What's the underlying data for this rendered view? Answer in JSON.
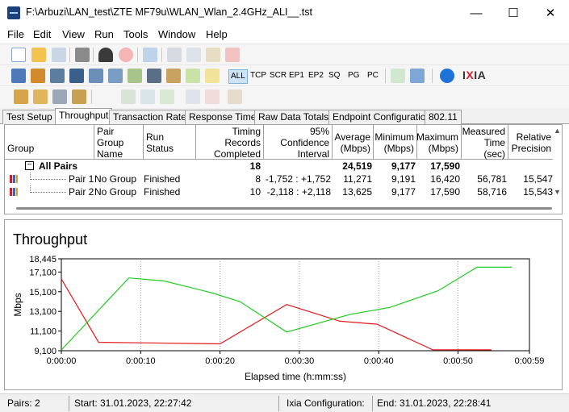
{
  "window": {
    "title": "F:\\Arbuzi\\LAN_test\\ZTE MF79u\\WLAN_Wlan_2.4GHz_ALI__.tst",
    "minimize": "—",
    "maximize": "☐",
    "close": "✕"
  },
  "menu": [
    "File",
    "Edit",
    "View",
    "Run",
    "Tools",
    "Window",
    "Help"
  ],
  "toolbar2": {
    "all": "ALL",
    "tcp": "TCP",
    "scr": "SCR",
    "ep1": "EP1",
    "ep2": "EP2",
    "sq": "SQ",
    "pg": "PG",
    "pc": "PC",
    "logo_i": "I",
    "logo_x": "X",
    "logo_rest": "IA"
  },
  "tabs": [
    "Test Setup",
    "Throughput",
    "Transaction Rate",
    "Response Time",
    "Raw Data Totals",
    "Endpoint Configuration",
    "802.11"
  ],
  "table": {
    "headers": {
      "group": "Group",
      "pair_group_name": "Pair Group Name",
      "run_status": "Run Status",
      "timing_records": "Timing Records Completed",
      "confidence": "95% Confidence Interval",
      "average": "Average (Mbps)",
      "minimum": "Minimum (Mbps)",
      "maximum": "Maximum (Mbps)",
      "measured_time": "Measured Time (sec)",
      "relative_precision": "Relative Precision"
    },
    "all_pairs": {
      "expander": "−",
      "label": "All Pairs",
      "records": "18",
      "average": "24,519",
      "minimum": "9,177",
      "maximum": "17,590"
    },
    "rows": [
      {
        "pair": "Pair 1",
        "group": "No Group",
        "status": "Finished",
        "records": "8",
        "ci": "-1,752 : +1,752",
        "average": "11,271",
        "minimum": "9,191",
        "maximum": "16,420",
        "time": "56,781",
        "precision": "15,547"
      },
      {
        "pair": "Pair 2",
        "group": "No Group",
        "status": "Finished",
        "records": "10",
        "ci": "-2,118 : +2,118",
        "average": "13,625",
        "minimum": "9,177",
        "maximum": "17,590",
        "time": "58,716",
        "precision": "15,543"
      }
    ]
  },
  "chart_data": {
    "type": "line",
    "title": "Throughput",
    "xlabel": "Elapsed time (h:mm:ss)",
    "ylabel": "Mbps",
    "xlim": [
      0,
      59
    ],
    "ylim": [
      9100,
      18445
    ],
    "x_ticks": [
      {
        "v": 0,
        "label": "0:00:00"
      },
      {
        "v": 10,
        "label": "0:00:10"
      },
      {
        "v": 20,
        "label": "0:00:20"
      },
      {
        "v": 30,
        "label": "0:00:30"
      },
      {
        "v": 40,
        "label": "0:00:40"
      },
      {
        "v": 50,
        "label": "0:00:50"
      },
      {
        "v": 59,
        "label": "0:00:59"
      }
    ],
    "y_ticks": [
      {
        "v": 9100,
        "label": "9,100"
      },
      {
        "v": 11100,
        "label": "11,100"
      },
      {
        "v": 13100,
        "label": "13,100"
      },
      {
        "v": 15100,
        "label": "15,100"
      },
      {
        "v": 17100,
        "label": "17,100"
      },
      {
        "v": 18445,
        "label": "18,445"
      }
    ],
    "series": [
      {
        "color": "#e31a1c",
        "points": [
          [
            0,
            16400
          ],
          [
            4.7,
            9950
          ],
          [
            10.3,
            9900
          ],
          [
            20,
            9800
          ],
          [
            28.4,
            13800
          ],
          [
            35.1,
            12100
          ],
          [
            39.8,
            11800
          ],
          [
            46.8,
            9200
          ],
          [
            54.2,
            9191
          ]
        ]
      },
      {
        "color": "#22cc22",
        "points": [
          [
            0,
            9177
          ],
          [
            8.5,
            16500
          ],
          [
            12.9,
            16200
          ],
          [
            18.9,
            15000
          ],
          [
            22.5,
            14100
          ],
          [
            28.4,
            11000
          ],
          [
            36.4,
            12800
          ],
          [
            41.4,
            13500
          ],
          [
            47.5,
            15200
          ],
          [
            52.4,
            17590
          ],
          [
            56.8,
            17590
          ]
        ]
      }
    ]
  },
  "status": {
    "pairs": "Pairs: 2",
    "start": "Start: 31.01.2023, 22:27:42",
    "ixia_config": "Ixia Configuration:",
    "end": "End: 31.01.2023, 22:28:41"
  }
}
